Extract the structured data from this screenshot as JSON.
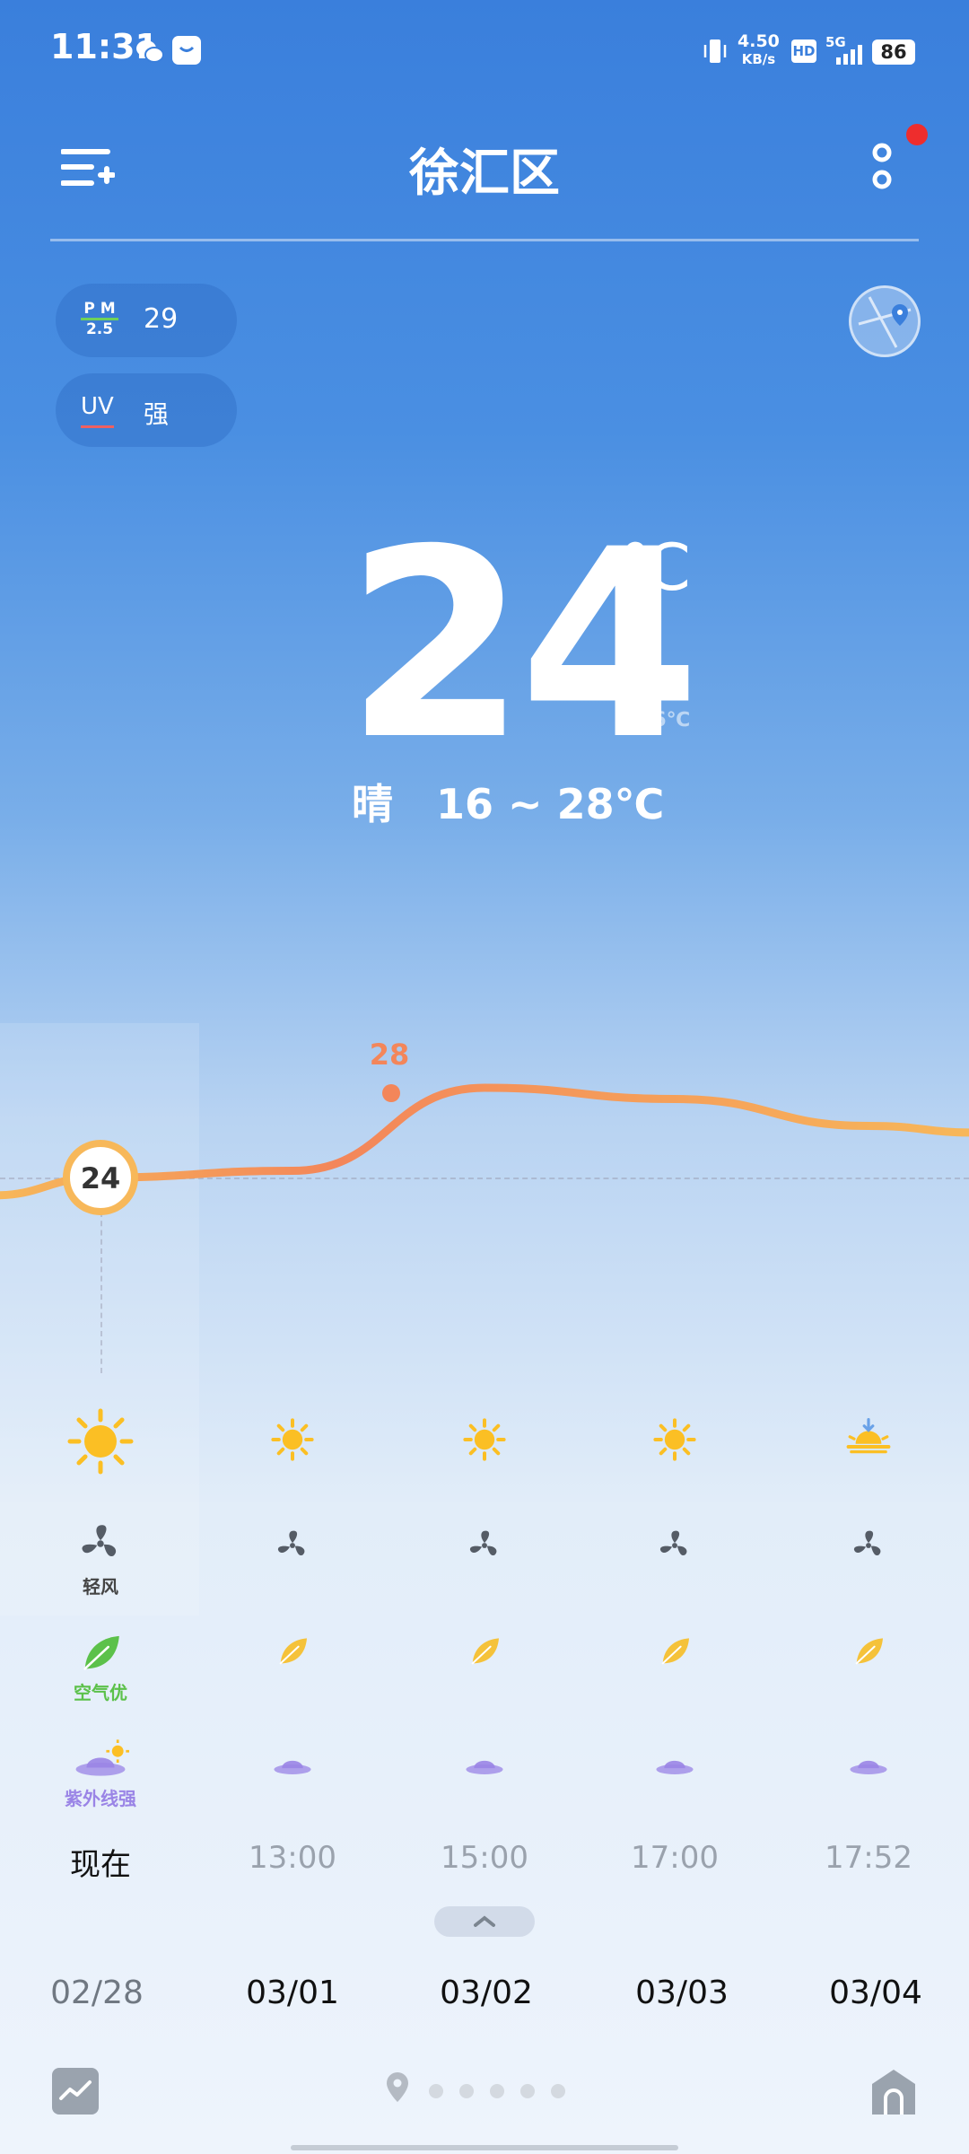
{
  "status_bar": {
    "time": "11:31",
    "net_speed": "4.50",
    "net_unit": "KB/s",
    "hd": "HD",
    "network": "5G",
    "battery": "86"
  },
  "header": {
    "title": "徐汇区",
    "has_notification_dot": true
  },
  "indicators": {
    "pm_label_top": "P M",
    "pm_label_bottom": "2.5",
    "pm_value": "29",
    "uv_label": "UV",
    "uv_value": "强"
  },
  "current": {
    "temperature": "24",
    "unit": "℃",
    "feels_like_label": "体感",
    "feels_like_value": "26℃",
    "condition": "晴",
    "range": "16 ~ 28℃"
  },
  "chart_data": {
    "type": "line",
    "x": [
      "现在",
      "13:00",
      "15:00",
      "17:00",
      "17:52"
    ],
    "y": [
      24,
      24.3,
      28,
      27.5,
      26.3
    ],
    "labeled_points": [
      {
        "x": "现在",
        "label": "24"
      },
      {
        "x": "15:00",
        "label": "28"
      }
    ],
    "colors": {
      "start": "#f7b85a",
      "peak": "#f3865a",
      "end": "#f7b85a"
    }
  },
  "hourly": [
    {
      "time": "现在",
      "icon": "sun-icon",
      "wind": "轻风",
      "air": "空气优",
      "uv": "紫外线强",
      "current": true
    },
    {
      "time": "13:00",
      "icon": "sun-icon",
      "current": false
    },
    {
      "time": "15:00",
      "icon": "sun-icon",
      "current": false
    },
    {
      "time": "17:00",
      "icon": "sun-icon",
      "current": false
    },
    {
      "time": "17:52",
      "icon": "sunset-icon",
      "current": false
    }
  ],
  "dates": [
    "02/28",
    "03/01",
    "03/02",
    "03/03",
    "03/04"
  ],
  "bottom_nav": {
    "page_dots": 5,
    "active_page": 0
  },
  "colors": {
    "wind": "#555c66",
    "air_good": "#5cc14a",
    "leaf": "#f5c23a",
    "uv": "#9a84e6",
    "sun": "#fbbf24"
  }
}
